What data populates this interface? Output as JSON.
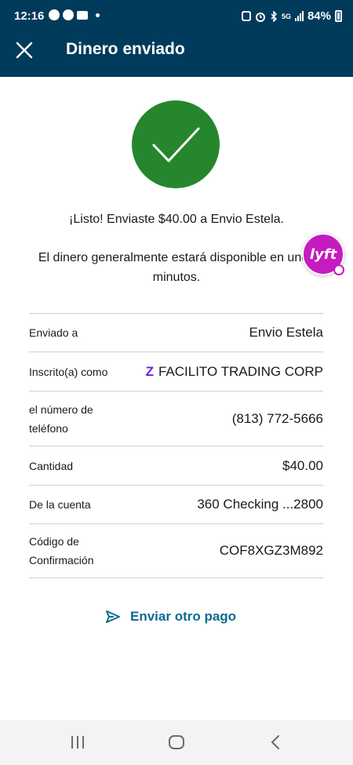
{
  "status_bar": {
    "time": "12:16",
    "battery": "84%",
    "network": "5G"
  },
  "header": {
    "title": "Dinero enviado",
    "close_icon": "close-icon",
    "background": "#013b5c"
  },
  "success": {
    "icon": "checkmark-icon",
    "color": "#25862d",
    "message": "¡Listo! Enviaste $40.00 a Envio Estela.",
    "submessage": "El dinero generalmente estará disponible en unos minutos."
  },
  "overlay": {
    "app": "lyft",
    "label": "lyft",
    "color": "#c51bbf"
  },
  "details": [
    {
      "label": "Enviado a",
      "value": "Envio Estela"
    },
    {
      "label": "Inscrito(a) como",
      "value": "FACILITO TRADING CORP"
    },
    {
      "label": "el número de teléfono",
      "value": "(813) 772-5666"
    },
    {
      "label": "Cantidad",
      "value": "$40.00"
    },
    {
      "label": "De la cuenta",
      "value": "360 Checking ...2800"
    },
    {
      "label": "Código de Confirmación",
      "value": "COF8XGZ3M892"
    }
  ],
  "actions": {
    "send_again_label": "Enviar otro pago",
    "send_again_icon": "send-icon",
    "accent": "#0d6b8e"
  },
  "nav": {
    "recent_icon": "recent-apps-icon",
    "home_icon": "home-icon",
    "back_icon": "back-icon"
  }
}
